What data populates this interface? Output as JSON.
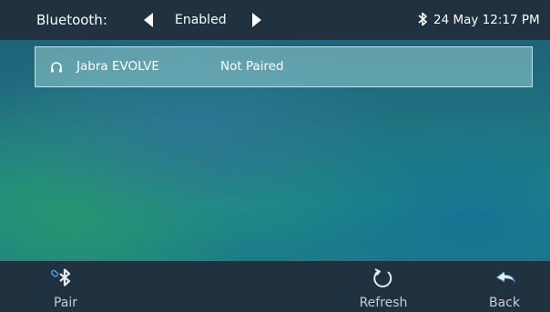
{
  "header": {
    "label": "Bluetooth:",
    "value": "Enabled",
    "status_icon": "bluetooth-icon",
    "datetime": "24 May 12:17 PM"
  },
  "device_list": {
    "items": [
      {
        "icon": "headset-icon",
        "name": "Jabra EVOLVE",
        "status": "Not Paired"
      }
    ]
  },
  "softkeys": {
    "pair": {
      "label": "Pair",
      "icon": "pair-bluetooth-icon"
    },
    "refresh": {
      "label": "Refresh",
      "icon": "refresh-icon"
    },
    "back": {
      "label": "Back",
      "icon": "back-arrow-icon"
    }
  },
  "colors": {
    "bar_background": "#203140",
    "softkey_text": "#c7cdd3",
    "accent_blue": "#4a9de0",
    "list_highlight": "#96cdd2"
  }
}
